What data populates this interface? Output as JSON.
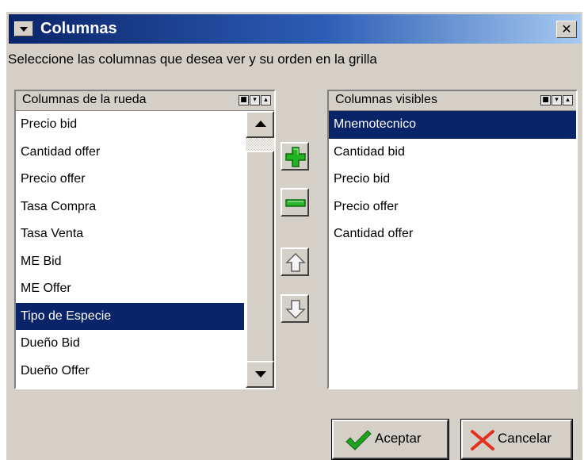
{
  "window": {
    "title": "Columnas",
    "close_symbol": "✕"
  },
  "instruction": "Seleccione las columnas que desea ver y su orden en la grilla",
  "left_list": {
    "header": "Columnas de la rueda",
    "items": [
      "Precio bid",
      "Cantidad offer",
      "Precio offer",
      "Tasa Compra",
      "Tasa Venta",
      "ME Bid",
      "ME Offer",
      "Tipo de Especie",
      "Dueño Bid",
      "Dueño Offer"
    ],
    "selected": "Tipo de Especie"
  },
  "right_list": {
    "header": "Columnas visibles",
    "items": [
      "Mnemotecnico",
      "Cantidad bid",
      "Precio bid",
      "Precio offer",
      "Cantidad offer"
    ],
    "selected": "Mnemotecnico"
  },
  "toolbar": {
    "add_icon": "plus-icon",
    "remove_icon": "minus-icon",
    "up_icon": "arrow-up-icon",
    "down_icon": "arrow-down-icon"
  },
  "buttons": {
    "accept": "Aceptar",
    "cancel": "Cancelar"
  },
  "colors": {
    "title_start": "#0a246a",
    "title_end": "#a6caf0",
    "selection": "#0a246a",
    "add": "#22b322",
    "remove": "#2db52d",
    "accept_check": "#22a022",
    "cancel_x": "#e53020"
  }
}
